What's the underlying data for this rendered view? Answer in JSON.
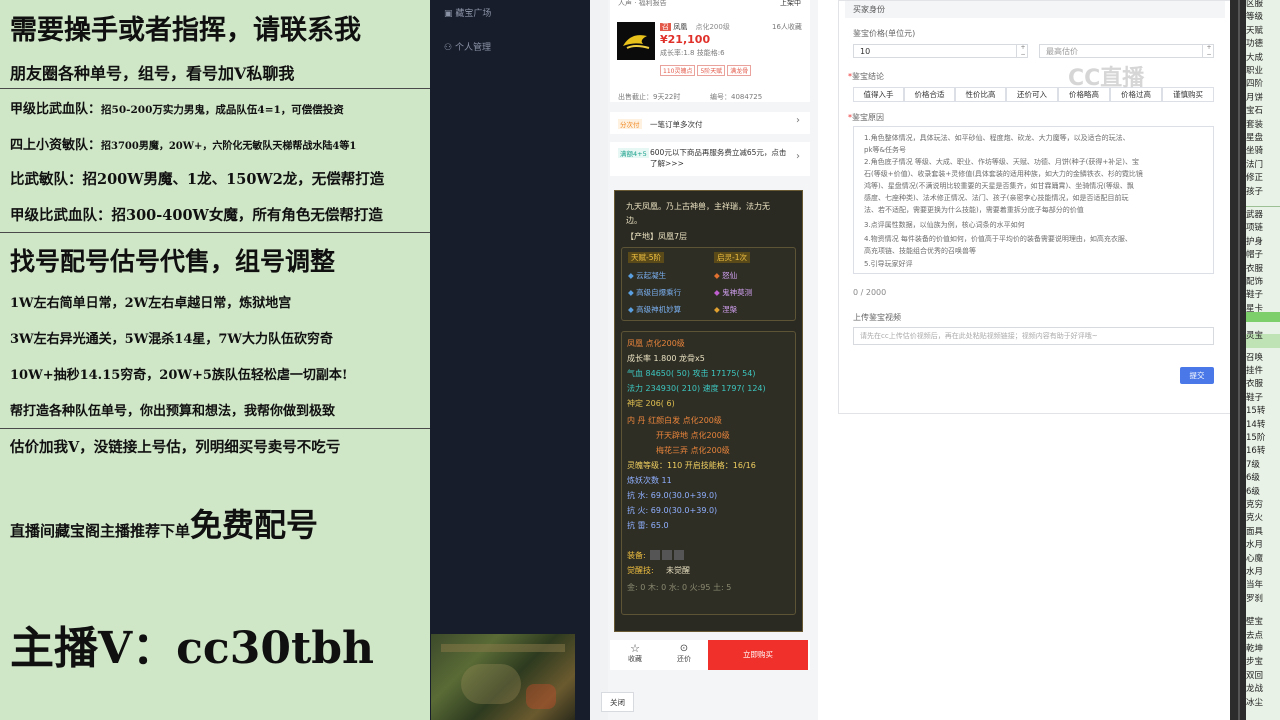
{
  "promo": {
    "title": "需要操手或者指挥，请联系我",
    "line1": "朋友圈各种单号，组号，看号加V私聊我",
    "line2_head": "甲级比武血队：",
    "line2_body": "招50-200万实力男鬼，成品队伍4=1，可偿偿投资",
    "line3_head": "四上小资敏队：",
    "line3_body": "招3700男魔，20W+，六阶化无敏队天梯帮战水陆4等1",
    "line4": "比武敏队：招200W男魔、1龙、150W2龙，无偿帮打造",
    "line5": "甲级比武血队：招300-400W女魔，所有角色无偿帮打造",
    "big1": "找号配号估号代售，组号调整",
    "line6": "1W左右简单日常，2W左右卓越日常，炼狱地宫",
    "line7": "3W左右异光通关，5W混杀14星，7W大力队伍砍穷奇",
    "line8": "10W+抽秒14.15穷奇，20W+5族队伍轻松虐一切副本!",
    "line9": "帮打造各种队伍单号，你出预算和想法，我帮你做到极致",
    "line10": "估价加我V，没链接上号估，列明细买号卖号不吃亏",
    "line11_small": "直播间藏宝阁主播推荐下单",
    "line11_big": "免费配号",
    "contact": "主播V：cc30tbh"
  },
  "sidebar": {
    "item1": "藏宝广场",
    "item2": "个人管理"
  },
  "product": {
    "top_left": "人声 · 福利报告",
    "top_right": "上架中",
    "name_badge": "召",
    "name": "凤凰",
    "level": "点化200级",
    "watchers": "16人收藏",
    "price": "¥21,100",
    "growth": "成长率:1.8 技能格:6",
    "tags": [
      "110灵魄点",
      "5阶天赋",
      "满龙骨"
    ],
    "time_label": "出售截止：9天22时",
    "id_label": "编号：4084725",
    "promo1_tag": "分次付",
    "promo1_text": "一笔订单多次付",
    "promo2_tag": "满额4+5",
    "promo2_text": "600元以下商品再服务费立减65元，点击了解>>>"
  },
  "pet": {
    "desc1": "九天凤凰。乃上古神兽，主祥瑞，法力无",
    "desc2": "边。",
    "origin": "【产地】凤凰7层",
    "talent": "天赋-5阶",
    "awaken": "启灵-1次",
    "skills": [
      "云起凝生",
      "怒仙",
      "高级自爆乘行",
      "鬼神莫测",
      "高级神机妙算",
      "涅槃"
    ],
    "name_line": "凤凰 点化200级",
    "growth_line": "成长率 1.800 龙骨x5",
    "hp": "气血 84650( 50) 攻击 17175( 54)",
    "mp": "法力 234930( 210) 速度 1797( 124)",
    "calm": "神定 206( 6)",
    "neidan1": "内  丹  红颜白发 点化200级",
    "neidan2": "开天辟地 点化200级",
    "neidan3": "梅花三弄 点化200级",
    "spirit": "灵魄等级：110 开启技能格：16/16",
    "refine": "炼妖次数 11",
    "res1": "抗  水: 69.0(30.0+39.0)",
    "res2": "抗  火: 69.0(30.0+39.0)",
    "res3": "抗  雷: 65.0",
    "equip_label": "装备:",
    "awaken_label": "觉醒技:",
    "awaken_val": "未觉醒",
    "elements": "金: 0 木: 0 水: 0 火:95 土: 5"
  },
  "actions": {
    "fav": "收藏",
    "bargain": "还价",
    "buy": "立即购买",
    "close": "关闭"
  },
  "form": {
    "section_title": "买家身份",
    "price_label": "鉴宝价格(单位元)",
    "price_value": "10",
    "max_placeholder": "最高估价",
    "conclusion_label": "鉴宝结论",
    "chips": [
      "值得入手",
      "价格合适",
      "性价比高",
      "还价可入",
      "价格略高",
      "价格过高",
      "谨慎购买"
    ],
    "reason_label": "鉴宝原因",
    "reason_lines": [
      "1.角色整体情况，具体玩法、如平砂仙、程度炮、砍龙、大力魔等，以及适合的玩法、",
      "pk等&任务号",
      "2.角色底子情况 等级、大成、职业、作坊等级、天赋、功德、月饼(种子(获得+补足)、宝",
      "石(等级+价值)、收录套装+灵修值(具体套装的适用种族，如大力的金鳞铁衣、杉的霓比镜",
      "鸿等)、星盘情况(不满说明比较重要的天星是否集齐，如甘霖踊霄)、坐骑情况(等级、飘",
      "感度、七座种类)、法术修正情况、法门、孩子(亲密李心技能情况，如是否适配目前玩",
      "法、若不适配，需要更换为什么技能)，需要着重拆分底子每部分的价值",
      "3.点评属性数据，以仙族为例，核心词条的水平如何",
      "4.物资情况 每件装备的价值如何，价值高于平均价的装备需要说明理由，如高充衣服、",
      "高充项链、技能组合优秀的召唤兽等",
      "5.引导玩家好评"
    ],
    "counter": "0 / 2000",
    "video_label": "上传鉴宝视频",
    "video_placeholder": "请先在cc上传估价视频后，再在此处粘贴视频链接；视频内容有助于好评哦~",
    "submit": "提交"
  },
  "watermark": "CC直播",
  "sheet": {
    "cells": [
      "区服",
      "等级",
      "天赋",
      "功德",
      "大成",
      "职业",
      "四阶",
      "月饼",
      "宝石",
      "套装",
      "星盘",
      "坐骑",
      "法门",
      "修正",
      "孩子",
      "武器",
      "项链",
      "护身",
      "帽子",
      "衣服",
      "配饰",
      "鞋子",
      "星卡",
      "灵宝",
      "召唤",
      "挂件",
      "衣服",
      "鞋子",
      "15转",
      "14转",
      "15阶",
      "16转",
      "7级",
      "6级",
      "6级",
      "克穷",
      "克火",
      "面具",
      "水月",
      "心魔",
      "水月",
      "当年",
      "罗刹",
      "壁宝",
      "去点",
      "乾坤",
      "步宝",
      "双回",
      "龙战",
      "冰尘"
    ]
  }
}
